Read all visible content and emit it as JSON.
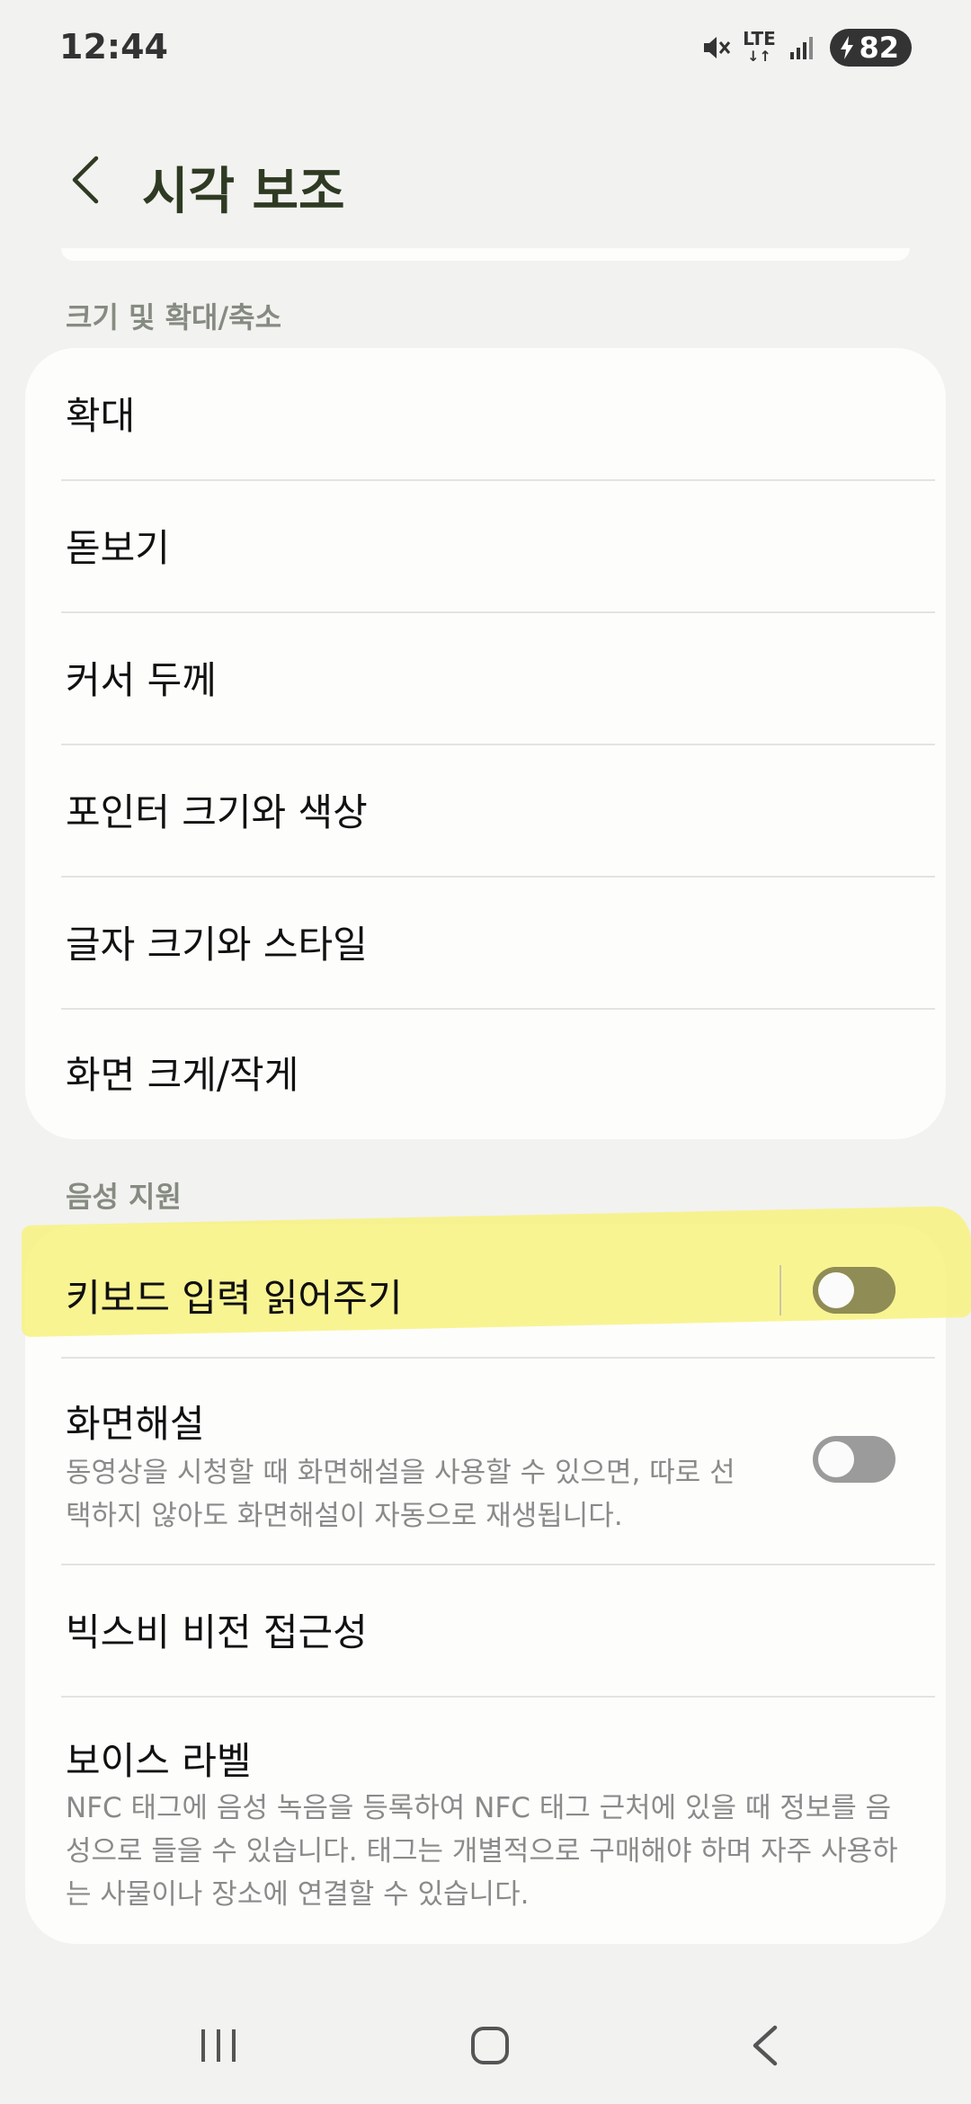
{
  "status": {
    "time": "12:44",
    "network": "LTE",
    "battery": "82"
  },
  "header": {
    "title": "시각 보조"
  },
  "sections": [
    {
      "title": "크기 및 확대/축소",
      "items": [
        {
          "label": "확대"
        },
        {
          "label": "돋보기"
        },
        {
          "label": "커서 두께"
        },
        {
          "label": "포인터 크기와 색상"
        },
        {
          "label": "글자 크기와 스타일"
        },
        {
          "label": "화면 크게/작게"
        }
      ]
    },
    {
      "title": "음성 지원",
      "items": [
        {
          "label": "키보드 입력 읽어주기",
          "toggle": "off"
        },
        {
          "label": "화면해설",
          "description": "동영상을 시청할 때 화면해설을 사용할 수 있으면, 따로 선택하지 않아도 화면해설이 자동으로 재생됩니다.",
          "toggle": "off"
        },
        {
          "label": "빅스비 비전 접근성"
        },
        {
          "label": "보이스 라벨",
          "description": "NFC 태그에 음성 녹음을 등록하여 NFC 태그 근처에 있을 때 정보를 음성으로 들을 수 있습니다. 태그는 개별적으로 구매해야 하며 자주 사용하는 사물이나 장소에 연결할 수 있습니다."
        }
      ]
    }
  ],
  "icons": {
    "back": "chevron-left-icon",
    "mute": "mute-icon",
    "signal": "signal-icon",
    "charging": "charging-bolt-icon",
    "nav_recents": "recent-apps-icon",
    "nav_home": "home-icon",
    "nav_back": "back-icon"
  },
  "colors": {
    "title": "#2f3a22",
    "highlight": "#f8f27f",
    "toggle_off": "#9b9b9b"
  }
}
